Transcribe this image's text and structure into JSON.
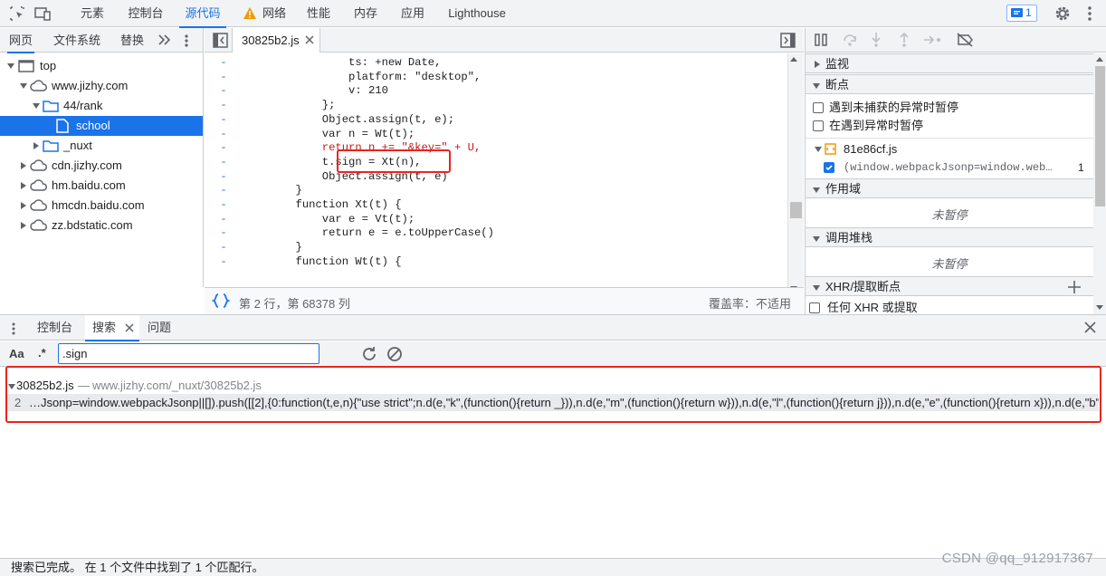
{
  "topbar": {
    "tabs": [
      "元素",
      "控制台",
      "源代码",
      "网络",
      "性能",
      "内存",
      "应用",
      "Lighthouse"
    ],
    "active_tab": "源代码",
    "issues_count": "1"
  },
  "navigator": {
    "tabs": [
      "网页",
      "文件系统",
      "替换"
    ],
    "tree": [
      {
        "label": "top"
      },
      {
        "label": "www.jizhy.com"
      },
      {
        "label": "44/rank"
      },
      {
        "label": "school"
      },
      {
        "label": "_nuxt"
      },
      {
        "label": "cdn.jizhy.com"
      },
      {
        "label": "hm.baidu.com"
      },
      {
        "label": "hmcdn.baidu.com"
      },
      {
        "label": "zz.bdstatic.com"
      }
    ]
  },
  "editor": {
    "file_tab": "30825b2.js",
    "status_position": "第 2 行，第 68378 列",
    "status_coverage": "覆盖率：不适用",
    "gutter_marker": "-",
    "code_lines": [
      "                ts: +new Date,",
      "                platform: \"desktop\",",
      "                v: 210",
      "            };",
      "            Object.assign(t, e);",
      "            var n = Wt(t);",
      "            return n += \"&key=\" + U,",
      "            t.sign = Xt(n),",
      "            Object.assign(t, e)",
      "        }",
      "        function Xt(t) {",
      "            var e = Vt(t);",
      "            return e = e.toUpperCase()",
      "        }",
      "        function Wt(t) {"
    ]
  },
  "debugger": {
    "sections": {
      "watch": "监视",
      "breakpoints": "断点",
      "scope": "作用域",
      "call_stack": "调用堆栈",
      "xhr": "XHR/提取断点"
    },
    "pause_uncaught": "遇到未捕获的异常时暂停",
    "pause_caught": "在遇到异常时暂停",
    "bp_file": "81e86cf.js",
    "bp_code": "(window.webpackJsonp=window.web…",
    "bp_line": "1",
    "not_paused": "未暂停",
    "xhr_any": "任何 XHR 或提取"
  },
  "drawer": {
    "tabs": [
      "控制台",
      "搜索",
      "问题"
    ],
    "active_tab": "搜索",
    "match_case": "Aa",
    "regex": ".*",
    "search_value": ".sign"
  },
  "results": {
    "file": "30825b2.js",
    "separator": "—",
    "path": "www.jizhy.com/_nuxt/30825b2.js",
    "line_no": "2",
    "snippet": "…Jsonp=window.webpackJsonp||[]).push([[2],{0:function(t,e,n){\"use strict\";n.d(e,\"k\",(function(){return _})),n.d(e,\"m\",(function(){return w})),n.d(e,\"l\",(function(){return j})),n.d(e,\"e\",(function(){return x})),n.d(e,\"b\",…"
  },
  "footer": {
    "status": "搜索已完成。 在 1 个文件中找到了 1 个匹配行。"
  },
  "watermark": "CSDN @qq_912917367",
  "colors": {
    "accent": "#1a73e8",
    "highlight_box": "#e8261f",
    "warning": "#f29900"
  }
}
